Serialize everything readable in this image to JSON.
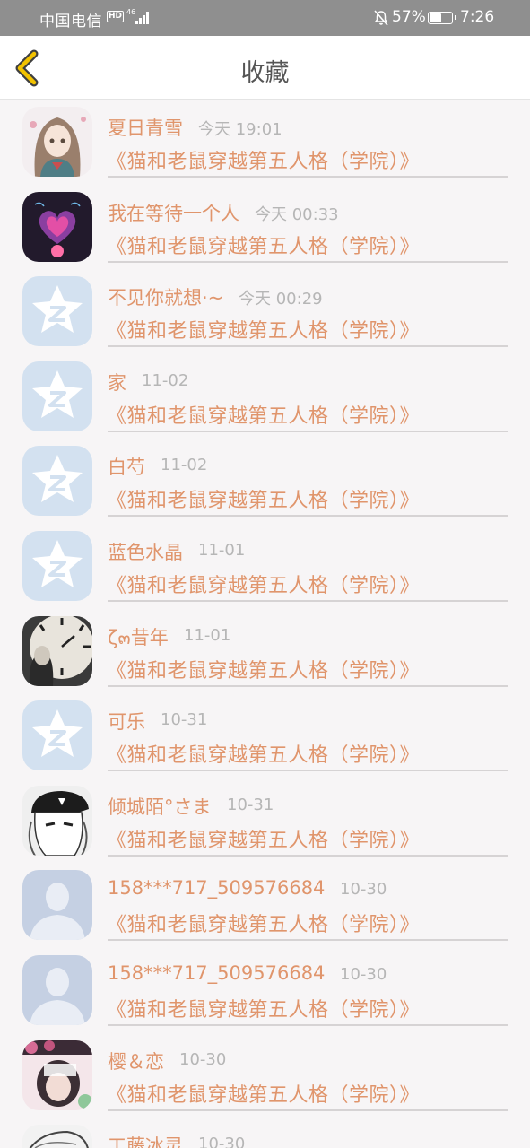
{
  "status_bar": {
    "carrier": "中国电信",
    "hd": "HD",
    "network": "46",
    "battery": "57%",
    "battery_level": 0.57,
    "time": "7:26"
  },
  "header": {
    "title": "收藏",
    "back_icon": "chevron-left-icon"
  },
  "colors": {
    "accent": "#e0956c",
    "back_icon": "#f2c200",
    "status_bar": "#8f8f8f",
    "time_gray": "#b6b6b6"
  },
  "favorites": [
    {
      "name": "夏日青雪",
      "time": "今天 19:01",
      "message": "《猫和老鼠穿越第五人格（学院）》",
      "avatar": "anime-girl"
    },
    {
      "name": "我在等待一个人",
      "time": "今天 00:33",
      "message": "《猫和老鼠穿越第五人格（学院）》",
      "avatar": "heart-image"
    },
    {
      "name": "不见你就想·~",
      "time": "今天 00:29",
      "message": "《猫和老鼠穿越第五人格（学院）》",
      "avatar": "qq-default"
    },
    {
      "name": "家",
      "time": "11-02",
      "message": "《猫和老鼠穿越第五人格（学院）》",
      "avatar": "qq-default"
    },
    {
      "name": "白芍",
      "time": "11-02",
      "message": "《猫和老鼠穿越第五人格（学院）》",
      "avatar": "qq-default"
    },
    {
      "name": "蓝色水晶",
      "time": "11-01",
      "message": "《猫和老鼠穿越第五人格（学院）》",
      "avatar": "qq-default"
    },
    {
      "name": "ζ๓昔年",
      "time": "11-01",
      "message": "《猫和老鼠穿越第五人格（学院）》",
      "avatar": "clock-photo"
    },
    {
      "name": "可乐",
      "time": "10-31",
      "message": "《猫和老鼠穿越第五人格（学院）》",
      "avatar": "qq-default"
    },
    {
      "name": "倾城陌°さま",
      "time": "10-31",
      "message": "《猫和老鼠穿越第五人格（学院）》",
      "avatar": "anime-cap"
    },
    {
      "name": "158***717_509576684",
      "time": "10-30",
      "message": "《猫和老鼠穿越第五人格（学院）》",
      "avatar": "person-silhouette"
    },
    {
      "name": "158***717_509576684",
      "time": "10-30",
      "message": "《猫和老鼠穿越第五人格（学院）》",
      "avatar": "person-silhouette"
    },
    {
      "name": "樱＆恋",
      "time": "10-30",
      "message": "《猫和老鼠穿越第五人格（学院）》",
      "avatar": "pink-collage"
    },
    {
      "name": "工藤冰灵",
      "time": "10-30",
      "message": "",
      "avatar": "sketch-girl"
    }
  ]
}
